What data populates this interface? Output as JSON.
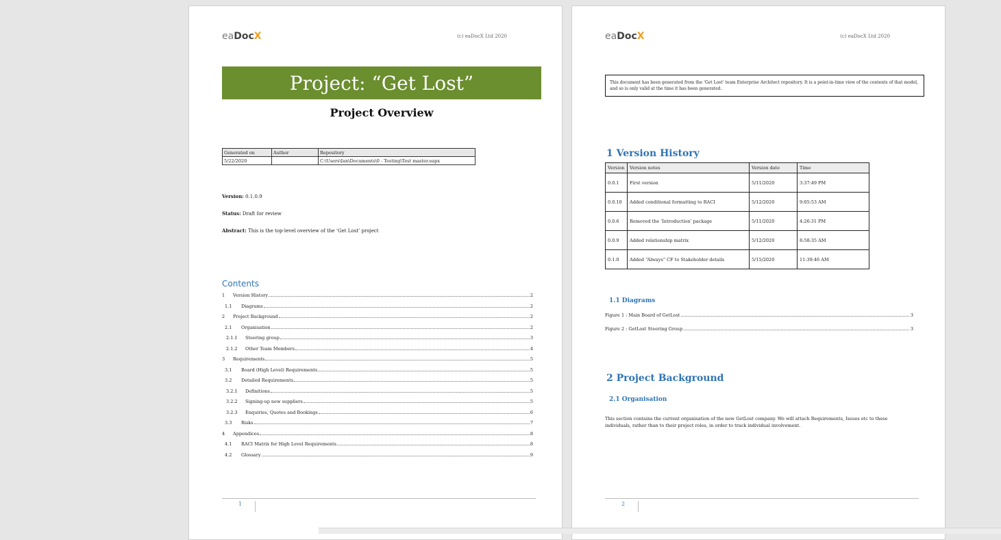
{
  "logo": {
    "ea": "ea",
    "doc": "Doc",
    "x": "X"
  },
  "copyright": "(c) eaDocX Ltd 2020",
  "page1": {
    "title": "Project: “Get Lost”",
    "subtitle": "Project Overview",
    "meta_table": {
      "headers": [
        "Generated on",
        "Author",
        "Repository"
      ],
      "values": [
        "5/22/2020",
        "",
        "C:\\Users\\Ian\\Documents\\0 - Testing\\Test master.eapx"
      ]
    },
    "version_label": "Version:",
    "version_value": "0.1.0.9",
    "status_label": "Status:",
    "status_value": "Draft for review",
    "abstract_label": "Abstract:",
    "abstract_value": "This is the top-level overview of the ‘Get Lost’ project",
    "contents_heading": "Contents",
    "toc": [
      {
        "num": "1",
        "text": "Version History",
        "page": "2"
      },
      {
        "num": "1.1",
        "text": "Diagrams",
        "page": "2"
      },
      {
        "num": "2",
        "text": "Project Background",
        "page": "2"
      },
      {
        "num": "2.1",
        "text": "Organisation",
        "page": "2"
      },
      {
        "num": "2.1.1",
        "text": "Steering group",
        "page": "3"
      },
      {
        "num": "2.1.2",
        "text": "Other Team Members",
        "page": "4"
      },
      {
        "num": "3",
        "text": "Requirements",
        "page": "5"
      },
      {
        "num": "3.1",
        "text": "Board (High Level) Requirements",
        "page": "5"
      },
      {
        "num": "3.2",
        "text": "Detailed Requirements",
        "page": "5"
      },
      {
        "num": "3.2.1",
        "text": "Definitions",
        "page": "5"
      },
      {
        "num": "3.2.2",
        "text": "Signing-up new suppliers",
        "page": "5"
      },
      {
        "num": "3.2.3",
        "text": "Enquiries, Quotes and Bookings",
        "page": "6"
      },
      {
        "num": "3.3",
        "text": "Risks",
        "page": "7"
      },
      {
        "num": "4",
        "text": "Appendices",
        "page": "8"
      },
      {
        "num": "4.1",
        "text": "RACI Matrix for High Level Requirements",
        "page": "8"
      },
      {
        "num": "4.2",
        "text": "Glossary",
        "page": "9"
      }
    ],
    "page_number": "1"
  },
  "page2": {
    "notice": "This document has been  generated from the ‘Get Lost’ team Enterprise Architect repository. It is a point-in-time view of the contents of that model, and so is only valid at the time it has been generated.",
    "version_history_heading": "1  Version History",
    "history_table": {
      "headers": [
        "Version",
        "Version notes",
        "Version date",
        "Time"
      ],
      "rows": [
        [
          "0.0.1",
          "First version",
          "5/11/2020",
          "3:37:49 PM"
        ],
        [
          "0.0.10",
          "Added conditional formatting to RACI",
          "5/12/2020",
          "9:05:53 AM"
        ],
        [
          "0.0.6",
          "Removed the ‘Introduction’ package",
          "5/11/2020",
          "4:26:31 PM"
        ],
        [
          "0.0.9",
          "Added relationship matrix",
          "5/12/2020",
          "8:58:35 AM"
        ],
        [
          "0.1.0",
          "Added “Always” CF to Stakeholder details",
          "5/15/2020",
          "11:39:46 AM"
        ]
      ]
    },
    "diagrams_heading": "1.1  Diagrams",
    "figures": [
      {
        "text": "Figure 1 : Main Board of GetLost",
        "page": "3"
      },
      {
        "text": "Figure 2 : GetLost Steering Group",
        "page": "3"
      }
    ],
    "background_heading": "2  Project Background",
    "organisation_heading": "2.1  Organisation",
    "organisation_text": "This section contains the current organisation of the new GetLost company. We will attach Requirements, Issues etc to these individuals, rather than to their project roles, in order to track individual involvement.",
    "page_number": "2"
  }
}
